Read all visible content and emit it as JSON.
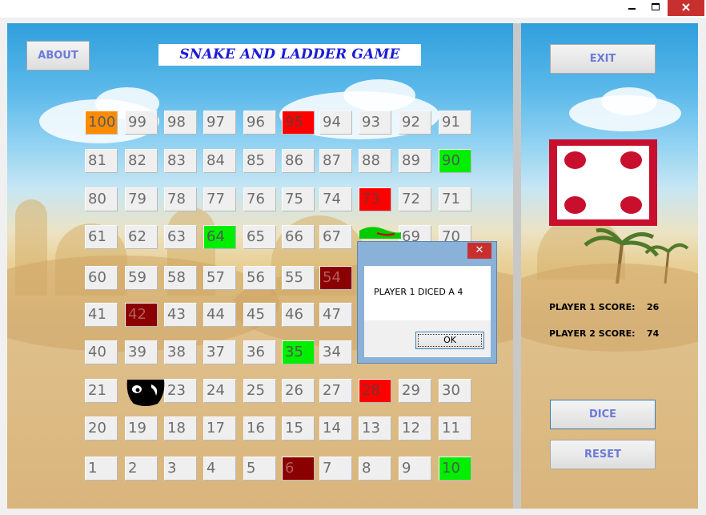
{
  "window": {
    "minimize": "–",
    "maximize": "□",
    "close": "✕"
  },
  "header": {
    "about_label": "ABOUT",
    "title": "SNAKE AND LADDER GAME",
    "exit_label": "EXIT"
  },
  "board": {
    "rows": [
      [
        "100",
        "99",
        "98",
        "97",
        "96",
        "95",
        "94",
        "93",
        "92",
        "91"
      ],
      [
        "81",
        "82",
        "83",
        "84",
        "85",
        "86",
        "87",
        "88",
        "89",
        "90"
      ],
      [
        "80",
        "79",
        "78",
        "77",
        "76",
        "75",
        "74",
        "73",
        "72",
        "71"
      ],
      [
        "61",
        "62",
        "63",
        "64",
        "65",
        "66",
        "67",
        "",
        "69",
        "70"
      ],
      [
        "60",
        "59",
        "58",
        "57",
        "56",
        "55",
        "54",
        "",
        "",
        ""
      ],
      [
        "41",
        "42",
        "43",
        "44",
        "45",
        "46",
        "47",
        "",
        "",
        ""
      ],
      [
        "40",
        "39",
        "38",
        "37",
        "36",
        "35",
        "34",
        "",
        "",
        ""
      ],
      [
        "21",
        "",
        "23",
        "24",
        "25",
        "26",
        "27",
        "28",
        "29",
        "30"
      ],
      [
        "20",
        "19",
        "18",
        "17",
        "16",
        "15",
        "14",
        "13",
        "12",
        "11"
      ],
      [
        "1",
        "2",
        "3",
        "4",
        "5",
        "6",
        "7",
        "8",
        "9",
        "10"
      ]
    ],
    "highlights": {
      "100": "orange",
      "95": "red",
      "90": "green",
      "73": "red",
      "64": "green",
      "54": "maroon",
      "42": "maroon",
      "35": "green",
      "28": "red",
      "6": "maroon",
      "10": "green"
    },
    "colors": {
      "orange": "#ff8c00",
      "red": "#ff0000",
      "maroon": "#8b0000",
      "green": "#00ee00"
    }
  },
  "dice": {
    "value": 4,
    "color": "#c8102e"
  },
  "scores": {
    "p1_label": "PLAYER 1 SCORE:",
    "p1_value": "26",
    "p2_label": "PLAYER 2 SCORE:",
    "p2_value": "74"
  },
  "controls": {
    "dice_label": "DICE",
    "reset_label": "RESET"
  },
  "dialog": {
    "message": "PLAYER 1 DICED A  4",
    "ok_label": "OK",
    "close": "✕"
  }
}
